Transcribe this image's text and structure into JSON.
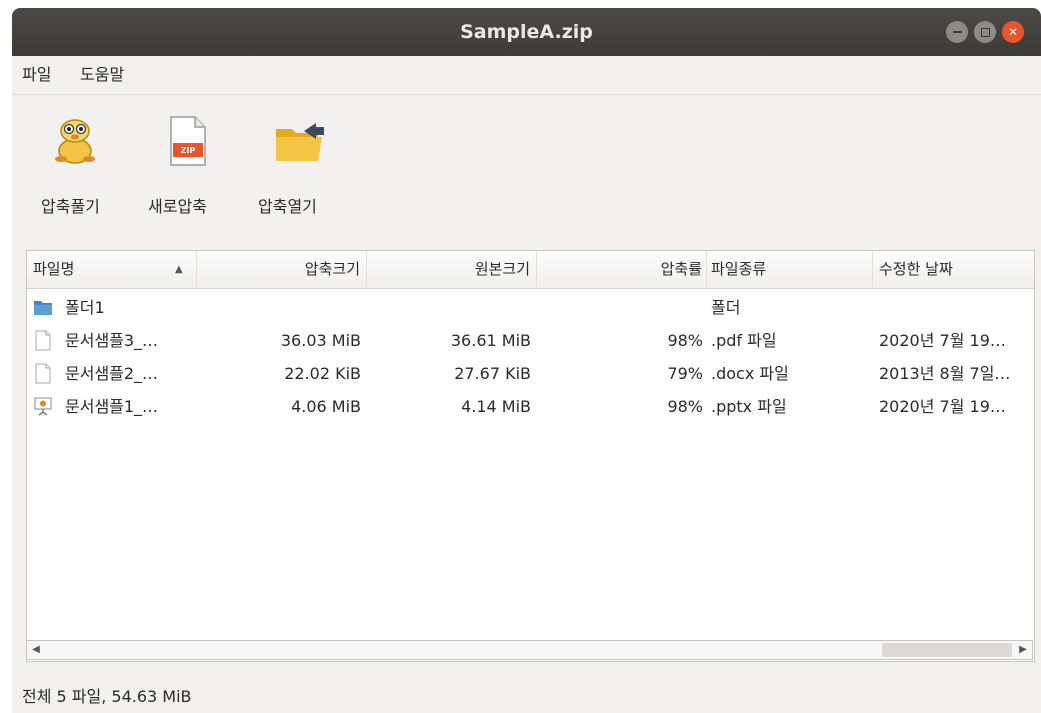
{
  "window": {
    "title": "SampleA.zip"
  },
  "menu": [
    {
      "label": "파일"
    },
    {
      "label": "도움말"
    }
  ],
  "toolbar": [
    {
      "label": "압축풀기",
      "icon": "extract-icon"
    },
    {
      "label": "새로압축",
      "icon": "zip-file-icon"
    },
    {
      "label": "압축열기",
      "icon": "open-folder-icon"
    }
  ],
  "table": {
    "columns": [
      "파일명",
      "압축크기",
      "원본크기",
      "압축률",
      "파일종류",
      "수정한 날짜"
    ],
    "sort": {
      "column": "파일명",
      "direction": "ascending"
    },
    "rows": [
      {
        "icon": "folder-icon",
        "name": "폴더1",
        "compressed": "",
        "original": "",
        "ratio": "",
        "type": "폴더",
        "modified": ""
      },
      {
        "icon": "document-icon",
        "name": "문서샘플3_…",
        "compressed": "36.03 MiB",
        "original": "36.61 MiB",
        "ratio": "98%",
        "type": ".pdf 파일",
        "modified": "2020년 7월 19…"
      },
      {
        "icon": "document-icon",
        "name": "문서샘플2_…",
        "compressed": "22.02 KiB",
        "original": "27.67 KiB",
        "ratio": "79%",
        "type": ".docx 파일",
        "modified": "2013년 8월 7일…"
      },
      {
        "icon": "presentation-icon",
        "name": "문서샘플1_…",
        "compressed": "4.06 MiB",
        "original": "4.14 MiB",
        "ratio": "98%",
        "type": ".pptx 파일",
        "modified": "2020년 7월 19…"
      }
    ]
  },
  "status": "전체 5 파일, 54.63 MiB",
  "colors": {
    "titlebar": "#3c3b37",
    "close": "#e9542b",
    "folder": "#5a9fd4",
    "zip": "#e9542b"
  }
}
